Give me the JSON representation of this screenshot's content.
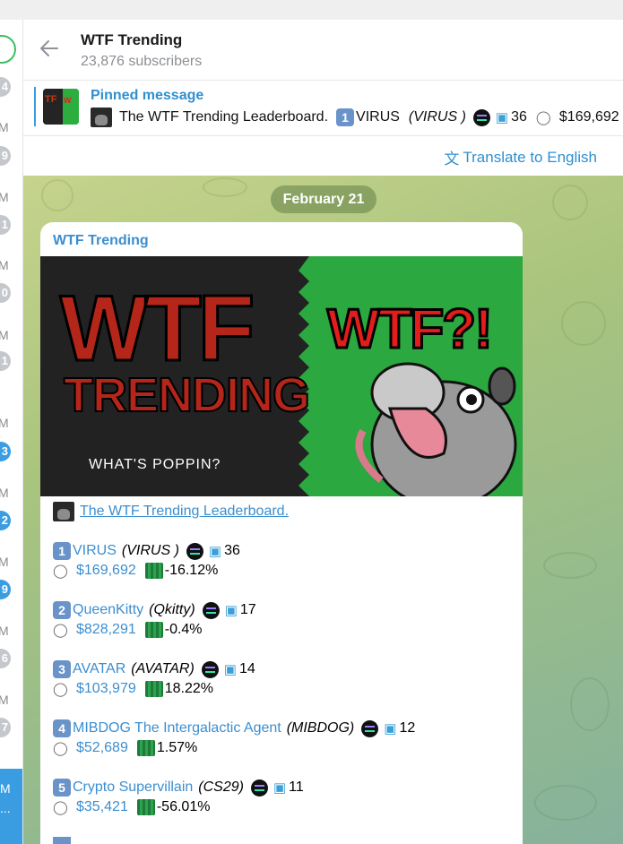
{
  "channel": {
    "title": "WTF Trending",
    "subscribers": "23,876 subscribers"
  },
  "left_strip": {
    "times": [
      "M",
      "M",
      "M",
      "M",
      "M",
      "M",
      "M",
      "M",
      "M",
      "M"
    ],
    "badges": [
      "4",
      "9",
      "1",
      "0",
      "1",
      "3",
      "2",
      "9",
      "6",
      "7"
    ],
    "active_label": "M",
    "active_more": "..."
  },
  "pinned": {
    "label": "Pinned message",
    "text_title": "The WTF Trending Leaderboard.",
    "rank_num": "1",
    "token": "VIRUS",
    "ticker": "(VIRUS )",
    "holders": "36",
    "price": "$169,692"
  },
  "translate": {
    "label": "Translate to English"
  },
  "chat": {
    "date": "February 21",
    "message": {
      "author": "WTF Trending",
      "banner": {
        "wtf": "WTF",
        "trending": "TRENDING",
        "tagline": "WHAT'S POPPIN?",
        "wtf2": "WTF?!"
      },
      "heading": "The WTF Trending Leaderboard.",
      "items": [
        {
          "num": "1",
          "name": "VIRUS",
          "ticker": "(VIRUS )",
          "holders": "36",
          "price": "$169,692",
          "change": "-16.12%"
        },
        {
          "num": "2",
          "name": "QueenKitty",
          "ticker": "(Qkitty)",
          "holders": "17",
          "price": "$828,291",
          "change": "-0.4%"
        },
        {
          "num": "3",
          "name": "AVATAR",
          "ticker": "(AVATAR)",
          "holders": "14",
          "price": "$103,979",
          "change": "18.22%"
        },
        {
          "num": "4",
          "name": "MIBDOG The Intergalactic Agent",
          "ticker": "(MIBDOG)",
          "holders": "12",
          "price": "$52,689",
          "change": "1.57%"
        },
        {
          "num": "5",
          "name": "Crypto Supervillain",
          "ticker": "(CS29)",
          "holders": "11",
          "price": "$35,421",
          "change": "-56.01%"
        }
      ]
    }
  },
  "colors": {
    "accent": "#3b8ed0",
    "badge_blue": "#3a9de1",
    "chat_bg": "#a9c47e"
  }
}
